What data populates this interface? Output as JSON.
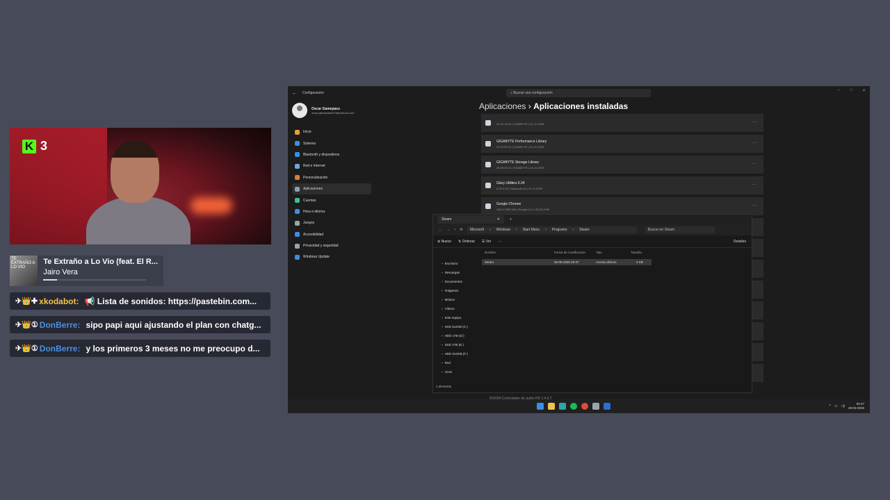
{
  "overlay": {
    "kick_count": "3",
    "song": {
      "title": "Te Extraño a Lo Vio (feat. El R...",
      "artist": "Jairo Vera",
      "cover_text": "TE EXTRAÑO A LO VIO",
      "progress": 0.13
    },
    "chat": [
      {
        "badges": "✈👑✚",
        "user": "xkodabot:",
        "user_color": "#f6c343",
        "msg": "📢  Lista de sonidos: https://pastebin.com..."
      },
      {
        "badges": "✈👑①",
        "user": "DonBerre:",
        "user_color": "#4a90e2",
        "msg": "sipo papi aqui ajustando el plan con chatg..."
      },
      {
        "badges": "✈👑①",
        "user": "DonBerre:",
        "user_color": "#4a90e2",
        "msg": "y los primeros 3 meses no me preocupo d..."
      }
    ]
  },
  "settings": {
    "window_title": "Configuración",
    "search_placeholder": "Buscar una configuración",
    "profile_name": "Oscar Gamepass",
    "profile_email": "oscar.gamepass913@outlook.com",
    "nav": [
      {
        "label": "Inicio",
        "color": "#e8a03c"
      },
      {
        "label": "Sistema",
        "color": "#3a8ee6"
      },
      {
        "label": "Bluetooth y dispositivos",
        "color": "#3a8ee6"
      },
      {
        "label": "Red e Internet",
        "color": "#6fa8dc"
      },
      {
        "label": "Personalización",
        "color": "#e07b39"
      },
      {
        "label": "Aplicaciones",
        "color": "#8aa0b8"
      },
      {
        "label": "Cuentas",
        "color": "#3fbf8f"
      },
      {
        "label": "Hora e idioma",
        "color": "#3a8ee6"
      },
      {
        "label": "Juegos",
        "color": "#9aa4b0"
      },
      {
        "label": "Accesibilidad",
        "color": "#3a8ee6"
      },
      {
        "label": "Privacidad y seguridad",
        "color": "#9aa4b0"
      },
      {
        "label": "Windows Update",
        "color": "#3a8ee6"
      }
    ],
    "selected_nav": "Aplicaciones",
    "breadcrumb_parent": "Aplicaciones",
    "breadcrumb_sep": "›",
    "breadcrumb_current": "Aplicaciones instaladas",
    "apps": [
      {
        "name": "",
        "sub": "25.10.16.01  |  GIGABYTE  |  21-11-2025"
      },
      {
        "name": "GIGABYTE Performance Library",
        "sub": "25.10.30.01  |  GIGABYTE  |  21-11-2025"
      },
      {
        "name": "GIGABYTE Storage Library",
        "sub": "25.08.22.01  |  GIGABYTE  |  04-10-2025"
      },
      {
        "name": "Glary Utilities 6.34",
        "sub": "6.34.0.38  |  Glarysoft Ltd  |  21-11-2025"
      },
      {
        "name": "Google Chrome",
        "sub": "146.0.7680.165  |  Google LLC  |  25-03-2026"
      }
    ],
    "bottom_app": "NVIDIA Controlador de audio HD 1.4.5.7"
  },
  "explorer": {
    "tab": "Steam",
    "path": [
      "Microsoft",
      "Windows",
      "Start Menu",
      "Programs",
      "Steam"
    ],
    "search_placeholder": "Buscar en Steam",
    "toolbar": {
      "new": "Nuevo",
      "sort": "Ordenar",
      "view": "Ver",
      "more": "···",
      "details": "Detalles"
    },
    "sidebar": [
      "Escritorio",
      "Descargas",
      "Documentos",
      "Imágenes",
      "Música",
      "Vídeos",
      "Este equipo",
      "SSD 512GB (C:)",
      "HDD 1TB (D:)",
      "SSD 1TB (E:)",
      "HDD 512GB (F:)",
      "Red",
      "Linux"
    ],
    "columns": [
      "Nombre",
      "Fecha de modificación",
      "Tipo",
      "Tamaño"
    ],
    "file": {
      "name": "Steam",
      "date": "06-05-2025 20:37",
      "type": "Acceso directo",
      "size": "2 KB"
    },
    "status": "1 elemento"
  },
  "taskbar": {
    "time": "05:47",
    "date": "29-03-2026"
  }
}
